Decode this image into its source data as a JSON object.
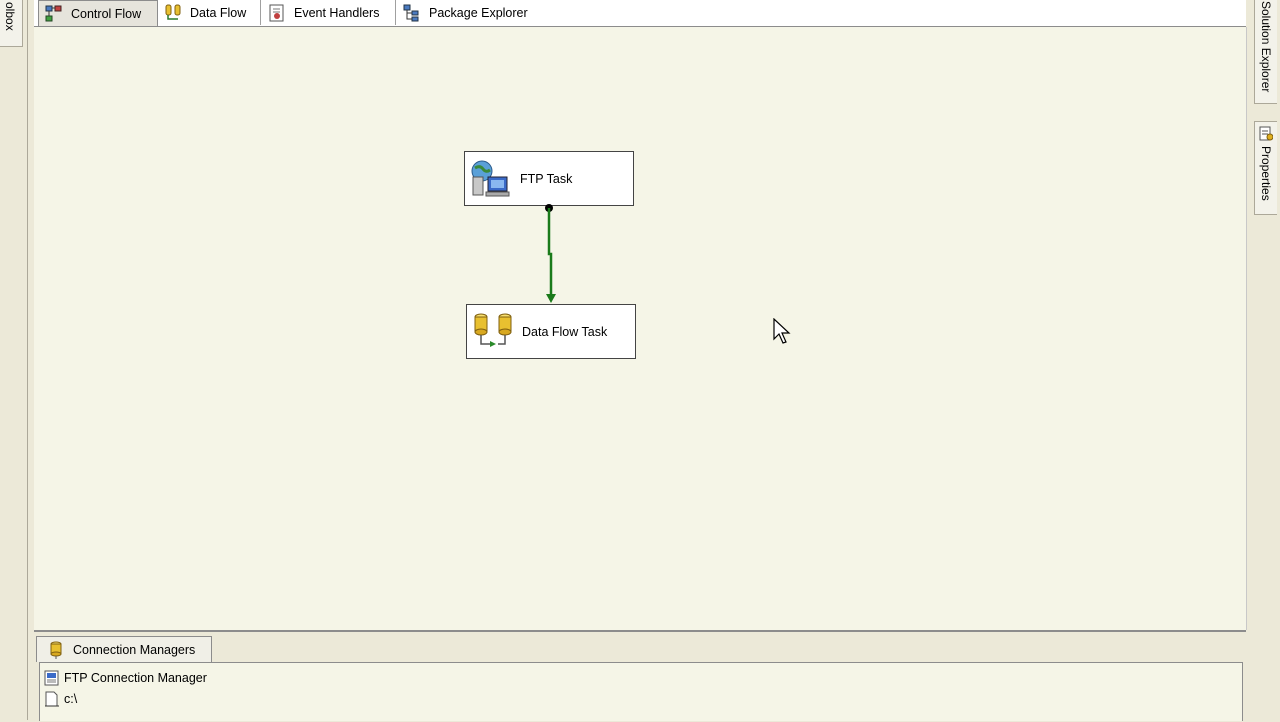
{
  "left_panel": {
    "toolbox_label": "olbox"
  },
  "right_panel": {
    "solution_explorer_label": "Solution Explorer",
    "properties_label": "Properties"
  },
  "tabs": [
    {
      "label": "Control Flow",
      "icon": "control-flow-icon",
      "active": true
    },
    {
      "label": "Data Flow",
      "icon": "data-flow-icon",
      "active": false
    },
    {
      "label": "Event Handlers",
      "icon": "event-handlers-icon",
      "active": false
    },
    {
      "label": "Package Explorer",
      "icon": "package-explorer-icon",
      "active": false
    }
  ],
  "canvas": {
    "tasks": [
      {
        "label": "FTP Task",
        "icon": "ftp-task-icon"
      },
      {
        "label": "Data Flow Task",
        "icon": "data-flow-task-icon"
      }
    ],
    "precedence_constraint": {
      "color": "#1a7a1a",
      "type": "success"
    }
  },
  "connection_managers": {
    "tab_label": "Connection Managers",
    "items": [
      {
        "label": "FTP Connection Manager",
        "icon": "ftp-connection-icon"
      },
      {
        "label": "c:\\",
        "icon": "file-connection-icon"
      }
    ]
  },
  "colors": {
    "canvas_bg": "#f5f5e7",
    "chrome_bg": "#ece9d8",
    "success_green": "#1a7a1a"
  }
}
